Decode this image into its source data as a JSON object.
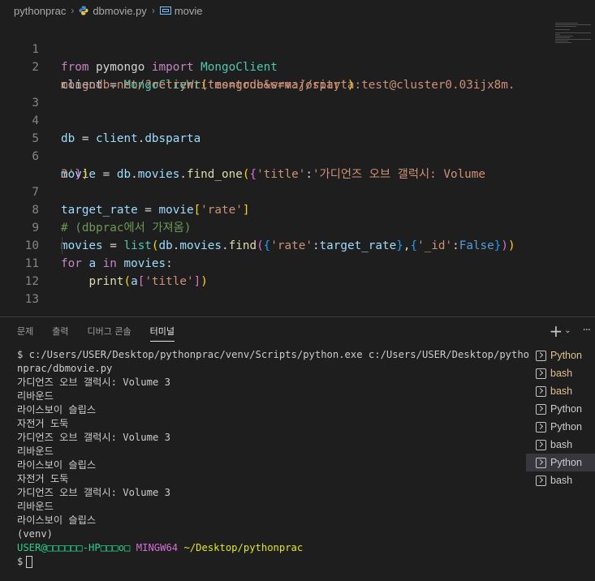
{
  "breadcrumb": {
    "folder": "pythonprac",
    "file": "dbmovie.py",
    "symbol": "movie"
  },
  "editor": {
    "line_numbers": [
      "1",
      "2",
      "",
      "3",
      "4",
      "5",
      "6",
      "",
      "7",
      "8",
      "9",
      "10",
      "11",
      "12",
      "13"
    ]
  },
  "panel": {
    "tabs": [
      "문제",
      "출력",
      "디버그 콘솔",
      "터미널"
    ],
    "active_tab": "터미널",
    "add_label": "+",
    "dropdown_label": "⌄",
    "more_label": "···"
  },
  "terminal": {
    "command_line_1": "$ c:/Users/USER/Desktop/pythonprac/venv/Scripts/python.exe c:/Users/USER/Desktop/pytho",
    "command_line_2": "nprac/dbmovie.py",
    "output": [
      "가디언즈 오브 갤럭시: Volume 3",
      "리바운드",
      "라이스보이 슬립스",
      "자전거 도둑",
      "가디언즈 오브 갤럭시: Volume 3",
      "리바운드",
      "라이스보이 슬립스",
      "자전거 도둑",
      "가디언즈 오브 갤럭시: Volume 3",
      "리바운드",
      "라이스보이 슬립스"
    ],
    "venv": "(venv)",
    "prompt_user": "USER@□□□□□□-HP□□□o□",
    "prompt_shell": "MINGW64",
    "prompt_path": "~/Desktop/pythonprac",
    "prompt_symbol": "$"
  },
  "terminal_list": [
    {
      "label": "Python"
    },
    {
      "label": "bash"
    },
    {
      "label": "bash"
    },
    {
      "label": "Python"
    },
    {
      "label": "Python"
    },
    {
      "label": "bash"
    },
    {
      "label": "Python"
    },
    {
      "label": "bash"
    }
  ],
  "colors": {
    "background": "#1e1e1e",
    "keyword": "#c586c0",
    "string": "#ce9178",
    "comment": "#6a9955",
    "terminal_green": "#23d18b",
    "terminal_magenta": "#d670d6",
    "terminal_yellow": "#e5e510"
  }
}
